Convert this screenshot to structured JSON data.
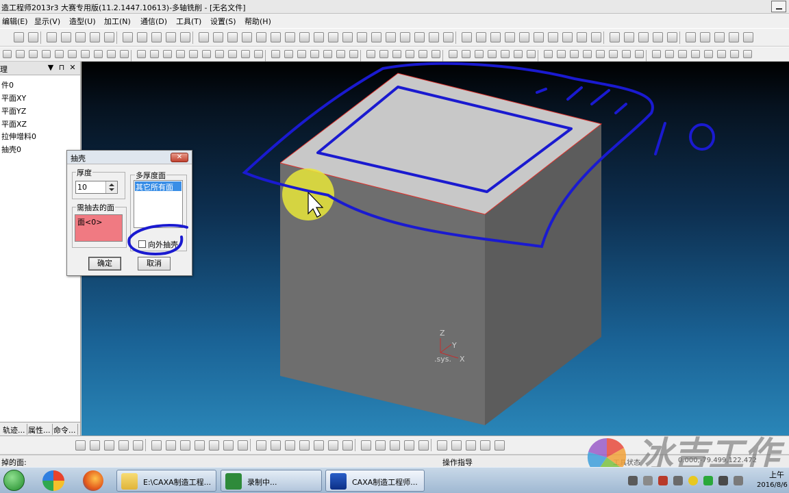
{
  "window": {
    "title": "造工程师2013r3 大赛专用版(11.2.1447.10613)-多轴铣削 - [无名文件]"
  },
  "menu": [
    "编辑(E)",
    "显示(V)",
    "造型(U)",
    "加工(N)",
    "通信(D)",
    "工具(T)",
    "设置(S)",
    "帮助(H)"
  ],
  "left_panel": {
    "title": "理",
    "pin_glyph": "▼ ⊓ ✕",
    "tree": [
      "件0",
      "平面XY",
      "平面YZ",
      "平面XZ",
      "拉伸增料0",
      "抽壳0"
    ],
    "tabs": [
      "轨迹...",
      "属性...",
      "命令..."
    ]
  },
  "dialog": {
    "title": "抽壳",
    "close_glyph": "✕",
    "thickness_label": "厚度",
    "thickness_value": "10",
    "remove_face_label": "需抽去的面",
    "remove_face_item": "面<0>",
    "multi_thick_label": "多厚度面",
    "multi_thick_item": "其它所有面",
    "outward_label": "向外抽壳",
    "outward_checked": false,
    "ok_label": "确定",
    "cancel_label": "取消"
  },
  "viewport": {
    "axis_labels": {
      "z": "Z",
      "y": "Y",
      "x": "X",
      "sys": ".sys."
    },
    "annotation_text": "10",
    "cursor_highlight_color": "#e8e63a",
    "cube_edge_color": "#e0302a",
    "ink_color": "#1a1ad0"
  },
  "status": {
    "left": "掉的面:",
    "middle": "操作指导",
    "state": "工具状态",
    "coords": "0.000,-79.499,122.472"
  },
  "watermark": {
    "text": "冰吉工作"
  },
  "taskbar": {
    "apps": [
      {
        "label": "E:\\CAXA制造工程..."
      },
      {
        "label": "录制中..."
      },
      {
        "label": "CAXA制造工程师..."
      }
    ],
    "time": "上午",
    "date": "2016/8/6"
  }
}
